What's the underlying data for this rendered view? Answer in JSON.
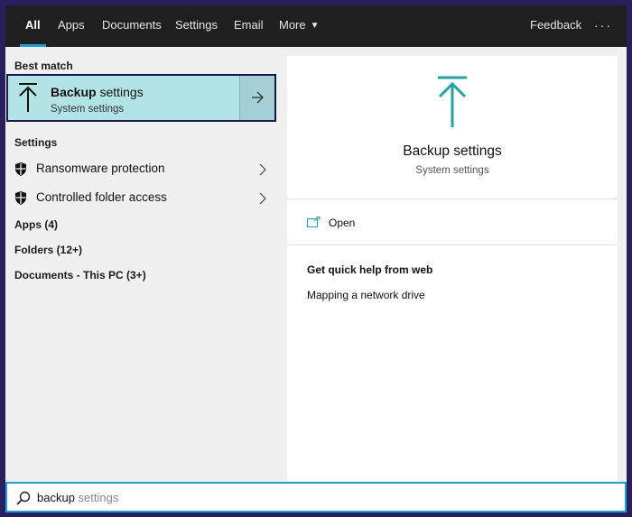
{
  "nav": {
    "tabs": [
      {
        "label": "All",
        "active": true
      },
      {
        "label": "Apps"
      },
      {
        "label": "Documents"
      },
      {
        "label": "Settings"
      },
      {
        "label": "Email"
      },
      {
        "label": "More"
      }
    ],
    "feedback": "Feedback",
    "more_options": "···"
  },
  "left": {
    "best_match_label": "Best match",
    "best_match": {
      "title_bold": "Backup",
      "title_rest": " settings",
      "subtitle": "System settings",
      "icon": "backup-arrow-icon"
    },
    "settings_label": "Settings",
    "settings_items": [
      {
        "label": "Ransomware protection",
        "icon": "shield-icon"
      },
      {
        "label": "Controlled folder access",
        "icon": "shield-icon"
      }
    ],
    "categories": [
      {
        "label": "Apps (4)"
      },
      {
        "label": "Folders (12+)"
      },
      {
        "label": "Documents - This PC (3+)"
      }
    ]
  },
  "preview": {
    "title": "Backup settings",
    "subtitle": "System settings",
    "open_label": "Open",
    "help_title": "Get quick help from web",
    "help_link": "Mapping a network drive"
  },
  "search": {
    "typed": "backup",
    "suggestion": " settings"
  },
  "colors": {
    "accent": "#19a0e0",
    "selected_bg": "#b2e4e6",
    "icon_teal": "#1fa5a5"
  }
}
